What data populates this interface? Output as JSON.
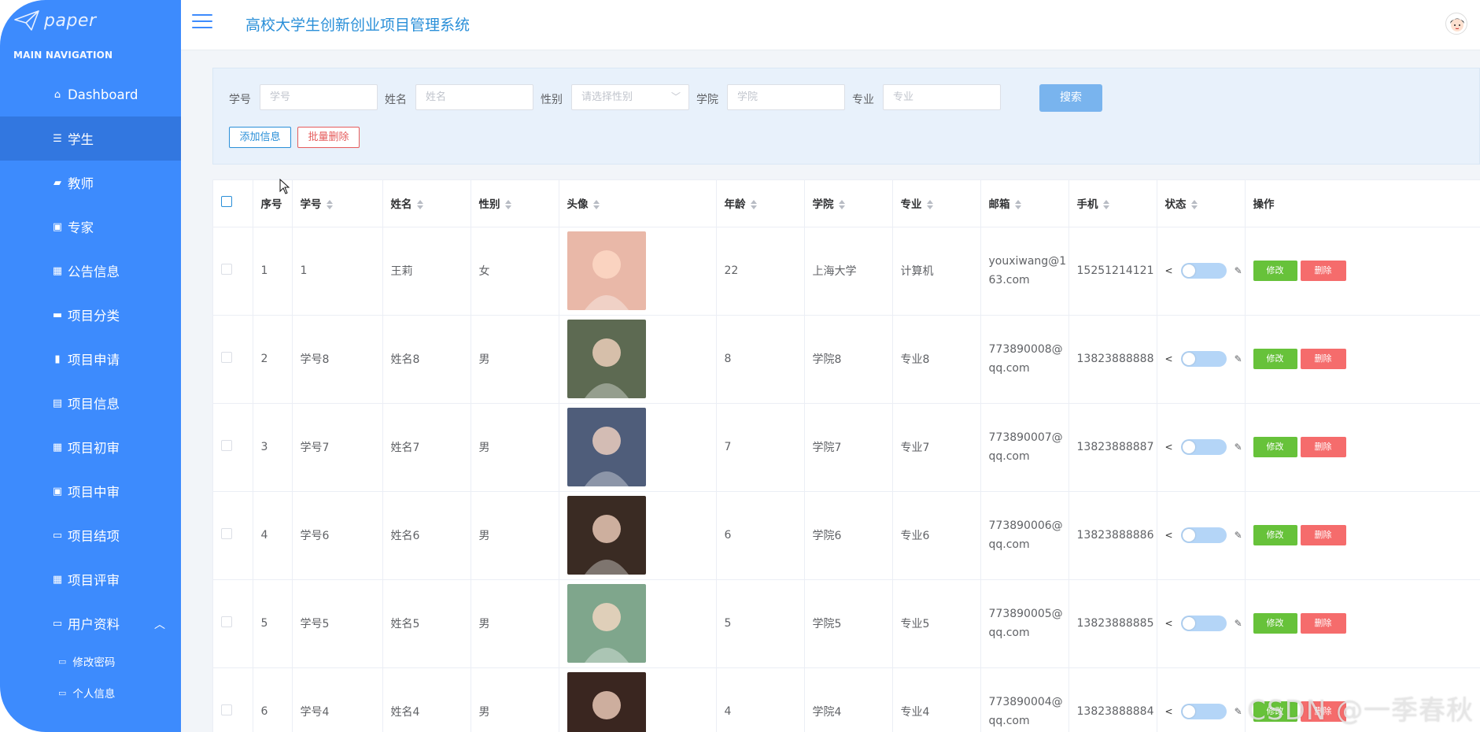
{
  "sidebar": {
    "logo_text": "paper",
    "nav_label": "MAIN NAVIGATION",
    "items": [
      {
        "label": "Dashboard",
        "icon": "home-icon"
      },
      {
        "label": "学生",
        "icon": "sliders-icon"
      },
      {
        "label": "教师",
        "icon": "teacher-icon"
      },
      {
        "label": "专家",
        "icon": "clipboard-icon"
      },
      {
        "label": "公告信息",
        "icon": "grid-icon"
      },
      {
        "label": "项目分类",
        "icon": "comment-icon"
      },
      {
        "label": "项目申请",
        "icon": "bar-chart-icon"
      },
      {
        "label": "项目信息",
        "icon": "briefcase-icon"
      },
      {
        "label": "项目初审",
        "icon": "grid-icon"
      },
      {
        "label": "项目中审",
        "icon": "clipboard-icon"
      },
      {
        "label": "项目结项",
        "icon": "monitor-icon"
      },
      {
        "label": "项目评审",
        "icon": "grid-icon"
      },
      {
        "label": "用户资料",
        "icon": "card-icon"
      }
    ],
    "active_index": 1,
    "sub_items": [
      {
        "label": "修改密码",
        "icon": "folder-icon"
      },
      {
        "label": "个人信息",
        "icon": "folder-icon"
      }
    ]
  },
  "header": {
    "title": "高校大学生创新创业项目管理系统"
  },
  "search": {
    "labels": {
      "xuehao": "学号",
      "xingming": "姓名",
      "xingbie": "性别",
      "xueyuan": "学院",
      "zhuanye": "专业"
    },
    "placeholders": {
      "xuehao": "学号",
      "xingming": "姓名",
      "xingbie": "请选择性别",
      "xueyuan": "学院",
      "zhuanye": "专业"
    },
    "search_button": "搜索",
    "add_button": "添加信息",
    "batch_delete_button": "批量删除"
  },
  "table": {
    "headers": [
      "序号",
      "学号",
      "姓名",
      "性别",
      "头像",
      "年龄",
      "学院",
      "专业",
      "邮箱",
      "手机",
      "状态",
      "操作"
    ],
    "edit_label": "修改",
    "delete_label": "删除",
    "rows": [
      {
        "index": "1",
        "id": "1",
        "name": "王莉",
        "gender": "女",
        "age": "22",
        "college": "上海大学",
        "major": "计算机",
        "email": "youxiwang@163.com",
        "phone": "15251214121",
        "photo_color": "#e9b8a8"
      },
      {
        "index": "2",
        "id": "学号8",
        "name": "姓名8",
        "gender": "男",
        "age": "8",
        "college": "学院8",
        "major": "专业8",
        "email": "773890008@qq.com",
        "phone": "13823888888",
        "photo_color": "#5d6a52"
      },
      {
        "index": "3",
        "id": "学号7",
        "name": "姓名7",
        "gender": "男",
        "age": "7",
        "college": "学院7",
        "major": "专业7",
        "email": "773890007@qq.com",
        "phone": "13823888887",
        "photo_color": "#4f5d7a"
      },
      {
        "index": "4",
        "id": "学号6",
        "name": "姓名6",
        "gender": "男",
        "age": "6",
        "college": "学院6",
        "major": "专业6",
        "email": "773890006@qq.com",
        "phone": "13823888886",
        "photo_color": "#3a2b23"
      },
      {
        "index": "5",
        "id": "学号5",
        "name": "姓名5",
        "gender": "男",
        "age": "5",
        "college": "学院5",
        "major": "专业5",
        "email": "773890005@qq.com",
        "phone": "13823888885",
        "photo_color": "#7fa68c"
      },
      {
        "index": "6",
        "id": "学号4",
        "name": "姓名4",
        "gender": "男",
        "age": "4",
        "college": "学院4",
        "major": "专业4",
        "email": "773890004@qq.com",
        "phone": "13823888884",
        "photo_color": "#3a2620"
      }
    ]
  },
  "watermark": "CSDN @一季春秋",
  "colors": {
    "sidebar": "#3d8bfd",
    "accent": "#2a8fd8",
    "edit": "#67c23a",
    "delete": "#f56c6c"
  }
}
